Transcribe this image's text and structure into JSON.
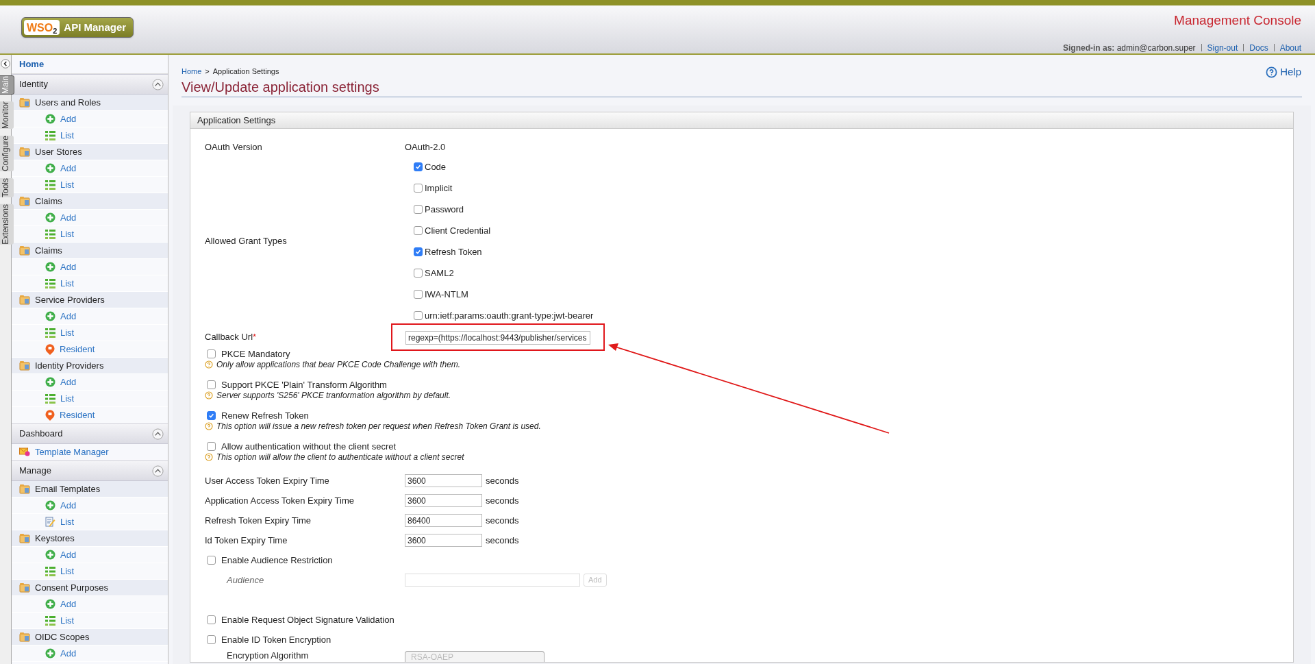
{
  "header": {
    "logo": {
      "brand": "WSO",
      "brand_sub": "2",
      "product": "API Manager"
    },
    "console_title": "Management Console",
    "signed_in_label": "Signed-in as:",
    "user": "admin@carbon.super",
    "links": [
      "Sign-out",
      "Docs",
      "About"
    ]
  },
  "side_tabs": [
    {
      "label": "Main",
      "selected": true
    },
    {
      "label": "Monitor",
      "selected": false
    },
    {
      "label": "Configure",
      "selected": false
    },
    {
      "label": "Tools",
      "selected": false
    },
    {
      "label": "Extensions",
      "selected": false
    }
  ],
  "sidebar": {
    "home": "Home",
    "sections": [
      {
        "title": "Identity",
        "expanded": true,
        "items": [
          {
            "label": "Users and Roles",
            "kind": "group",
            "children": [
              {
                "label": "Add",
                "kind": "add"
              },
              {
                "label": "List",
                "kind": "list"
              }
            ]
          },
          {
            "label": "User Stores",
            "kind": "group",
            "children": [
              {
                "label": "Add",
                "kind": "add"
              },
              {
                "label": "List",
                "kind": "list"
              }
            ]
          },
          {
            "label": "Claims",
            "kind": "group",
            "children": [
              {
                "label": "Add",
                "kind": "add"
              },
              {
                "label": "List",
                "kind": "list"
              }
            ]
          },
          {
            "label": "Claims",
            "kind": "group",
            "children": [
              {
                "label": "Add",
                "kind": "add"
              },
              {
                "label": "List",
                "kind": "list"
              }
            ]
          },
          {
            "label": "Service Providers",
            "kind": "group",
            "children": [
              {
                "label": "Add",
                "kind": "add"
              },
              {
                "label": "List",
                "kind": "list"
              },
              {
                "label": "Resident",
                "kind": "resident"
              }
            ]
          },
          {
            "label": "Identity Providers",
            "kind": "group",
            "children": [
              {
                "label": "Add",
                "kind": "add"
              },
              {
                "label": "List",
                "kind": "list"
              },
              {
                "label": "Resident",
                "kind": "resident"
              }
            ]
          }
        ]
      },
      {
        "title": "Dashboard",
        "expanded": true,
        "items": [
          {
            "label": "Template Manager",
            "kind": "link"
          }
        ]
      },
      {
        "title": "Manage",
        "expanded": true,
        "items": [
          {
            "label": "Email Templates",
            "kind": "group",
            "children": [
              {
                "label": "Add",
                "kind": "add"
              },
              {
                "label": "List",
                "kind": "edit"
              }
            ]
          },
          {
            "label": "Keystores",
            "kind": "group",
            "children": [
              {
                "label": "Add",
                "kind": "add"
              },
              {
                "label": "List",
                "kind": "list"
              }
            ]
          },
          {
            "label": "Consent Purposes",
            "kind": "group",
            "children": [
              {
                "label": "Add",
                "kind": "add"
              },
              {
                "label": "List",
                "kind": "list"
              }
            ]
          },
          {
            "label": "OIDC Scopes",
            "kind": "group",
            "children": [
              {
                "label": "Add",
                "kind": "add"
              }
            ]
          }
        ]
      }
    ]
  },
  "breadcrumb": [
    {
      "label": "Home",
      "link": true
    },
    {
      "label": "Application Settings",
      "link": false
    }
  ],
  "breadcrumb_separator": ">",
  "help": "Help",
  "title": "View/Update application settings",
  "panel": {
    "title": "Application Settings",
    "oauth_version": {
      "label": "OAuth Version",
      "value": "OAuth-2.0"
    },
    "grant_types": {
      "label": "Allowed Grant Types",
      "options": [
        {
          "label": "Code",
          "checked": true
        },
        {
          "label": "Implicit",
          "checked": false
        },
        {
          "label": "Password",
          "checked": false
        },
        {
          "label": "Client Credential",
          "checked": false
        },
        {
          "label": "Refresh Token",
          "checked": true
        },
        {
          "label": "SAML2",
          "checked": false
        },
        {
          "label": "IWA-NTLM",
          "checked": false
        },
        {
          "label": "urn:ietf:params:oauth:grant-type:jwt-bearer",
          "checked": false
        }
      ]
    },
    "callback": {
      "label": "Callback Url",
      "required": "*",
      "value": "regexp=(https://localhost:9443/publisher/services",
      "highlighted": true
    },
    "options": [
      {
        "label": "PKCE Mandatory",
        "checked": false,
        "hint": "Only allow applications that bear PKCE Code Challenge with them."
      },
      {
        "label": "Support PKCE 'Plain' Transform Algorithm",
        "checked": false,
        "hint": "Server supports 'S256' PKCE tranformation algorithm by default."
      },
      {
        "label": "Renew Refresh Token",
        "checked": true,
        "hint": "This option will issue a new refresh token per request when Refresh Token Grant is used."
      },
      {
        "label": "Allow authentication without the client secret",
        "checked": false,
        "hint": "This option will allow the client to authenticate without a client secret"
      }
    ],
    "expiry": [
      {
        "label": "User Access Token Expiry Time",
        "value": "3600",
        "unit": "seconds"
      },
      {
        "label": "Application Access Token Expiry Time",
        "value": "3600",
        "unit": "seconds"
      },
      {
        "label": "Refresh Token Expiry Time",
        "value": "86400",
        "unit": "seconds"
      },
      {
        "label": "Id Token Expiry Time",
        "value": "3600",
        "unit": "seconds"
      }
    ],
    "audience": {
      "label": "Enable Audience Restriction",
      "checked": false,
      "field_label": "Audience",
      "button": "Add"
    },
    "more_options": [
      {
        "label": "Enable Request Object Signature Validation",
        "checked": false
      },
      {
        "label": "Enable ID Token Encryption",
        "checked": false
      }
    ],
    "encryption": {
      "label": "Encryption Algorithm",
      "value": "RSA-OAEP"
    }
  }
}
